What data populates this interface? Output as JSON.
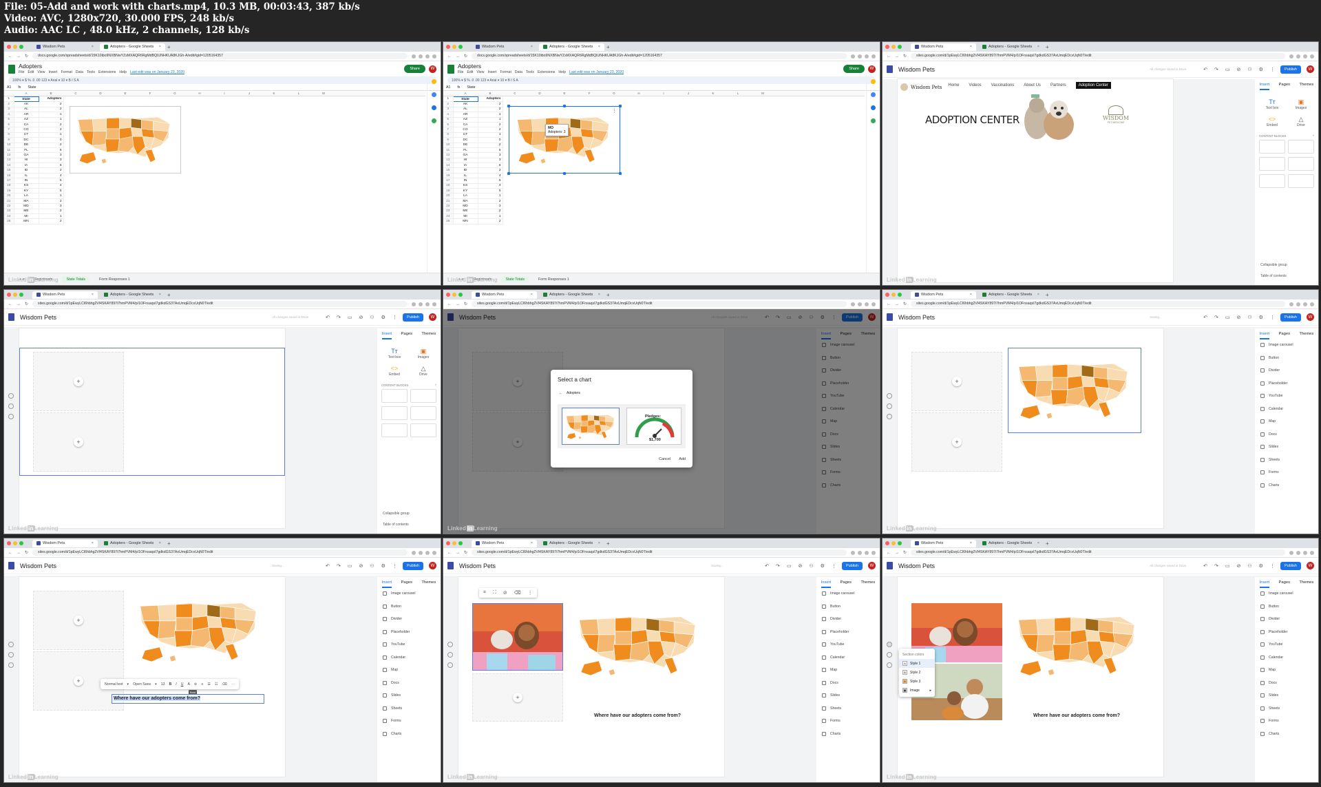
{
  "header": {
    "line1": "File: 05-Add and work with charts.mp4, 10.3 MB, 00:03:43, 387 kb/s",
    "line2": "Video: AVC, 1280x720, 30.000 FPS, 248 kb/s",
    "line3": "Audio: AAC LC , 48.0 kHz, 2 channels, 128 kb/s"
  },
  "watermark": "Linked",
  "watermark_in": "in",
  "watermark_tail": "Learning",
  "browser": {
    "tab_sheets": "Adopters - Google Sheets",
    "tab_site": "Wisdom Pets",
    "url_sheets": "docs.google.com/spreadsheets/d/15K10ibo9NXBNwYZsMXAQR6RgMdBQIUNHKUA8KJGh-A/edit#gid=1205164357",
    "url_site": "sites.google.com/d/1pEwyLCl6hbhg2Vl4SKAY897i7hmPVM4/p/1OFnsaqsI7gdkdGS37AxUmqEDcvUqN0T/edit"
  },
  "sheets": {
    "title": "Adopters",
    "menu": [
      "File",
      "Edit",
      "View",
      "Insert",
      "Format",
      "Data",
      "Tools",
      "Extensions",
      "Help"
    ],
    "last_edit": "Last edit was on January 23, 2020",
    "share": "Share",
    "avatar": "W",
    "toolbar": "100% ▾   $  %  .0  .00  123 ▾   Arial ▾   10 ▾   B  I  S  A",
    "cell_ref": "A1",
    "fx": "State",
    "col_headers": [
      "A",
      "B",
      "C",
      "D",
      "E",
      "F",
      "G",
      "H",
      "I",
      "J",
      "K",
      "L",
      "M"
    ],
    "header_row": {
      "state": "State",
      "adopters": "Adopters"
    },
    "rows": [
      [
        "AK",
        "2"
      ],
      [
        "AL",
        "2"
      ],
      [
        "AR",
        "1"
      ],
      [
        "AZ",
        "1"
      ],
      [
        "CA",
        "2"
      ],
      [
        "CO",
        "2"
      ],
      [
        "CT",
        "1"
      ],
      [
        "DC",
        "0"
      ],
      [
        "DE",
        "2"
      ],
      [
        "FL",
        "5"
      ],
      [
        "GA",
        "3"
      ],
      [
        "HI",
        "3"
      ],
      [
        "IA",
        "6"
      ],
      [
        "ID",
        "2"
      ],
      [
        "IL",
        "4"
      ],
      [
        "IN",
        "5"
      ],
      [
        "KS",
        "4"
      ],
      [
        "KY",
        "5"
      ],
      [
        "LA",
        "1"
      ],
      [
        "MA",
        "2"
      ],
      [
        "MD",
        "3"
      ],
      [
        "ME",
        "2"
      ],
      [
        "MI",
        "1"
      ],
      [
        "MN",
        "2"
      ]
    ],
    "tabs": [
      "Registrants",
      "State Totals",
      "Form Responses 1"
    ],
    "tooltip_state": "MO",
    "tooltip_value": "Adopters: 3"
  },
  "site": {
    "name": "Wisdom Pets",
    "saved": "All changes saved in Drive",
    "saving": "Saving...",
    "publish": "Publish",
    "nav": [
      "Home",
      "Videos",
      "Vaccinations",
      "About Us",
      "Partners",
      "Adoption Center"
    ],
    "logo_text": "Wisdom Pets",
    "hero_title": "ADOPTION CENTER",
    "hero_brand": "WISDOM",
    "hero_brand_sub": "PET MEDICINE",
    "panel_tabs": [
      "Insert",
      "Pages",
      "Themes"
    ],
    "insert_items": [
      {
        "icon": "Tт",
        "label": "Text box"
      },
      {
        "icon": "▣",
        "label": "Images"
      },
      {
        "icon": "<>",
        "label": "Embed"
      },
      {
        "icon": "△",
        "label": "Drive"
      }
    ],
    "content_blocks": "CONTENT BLOCKS",
    "collapsible": "Collapsible group",
    "toc": "Table of contents",
    "list_items": [
      "Image carousel",
      "Button",
      "Divider",
      "Placeholder",
      "YouTube",
      "Calendar",
      "Map",
      "Docs",
      "Slides",
      "Sheets",
      "Forms",
      "Charts"
    ],
    "dialog": {
      "title": "Select a chart",
      "source": "Adopters",
      "gauge_label": "Pledges:",
      "gauge_value": "$1,700",
      "cancel": "Cancel",
      "add": "Add"
    },
    "caption": "Where have our adopters come from?",
    "format_bar": {
      "style": "Normal text",
      "font": "Open Sans",
      "size": "13",
      "tip": "Bold"
    },
    "section_menu": {
      "title": "Section colors",
      "items": [
        "Style 1",
        "Style 2",
        "Style 3",
        "Image"
      ]
    }
  },
  "colors": {
    "light": "#f8dbb0",
    "mid": "#f4b870",
    "orange": "#f08c1e",
    "brown": "#a06a18",
    "publish": "#1a73e8"
  }
}
